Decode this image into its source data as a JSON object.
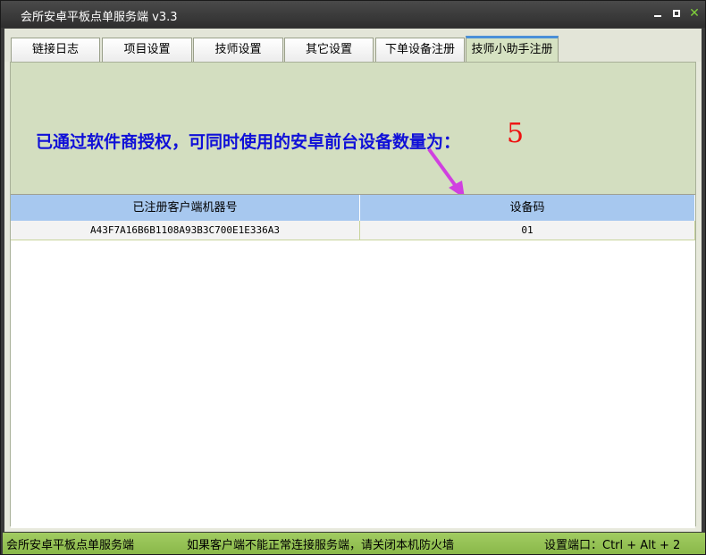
{
  "window": {
    "title": "会所安卓平板点单服务端 v3.3",
    "controls": [
      "minimize-icon",
      "maximize-icon",
      "close-icon"
    ]
  },
  "tabs": [
    {
      "label": "链接日志",
      "active": false
    },
    {
      "label": "项目设置",
      "active": false
    },
    {
      "label": "技师设置",
      "active": false
    },
    {
      "label": "其它设置",
      "active": false
    },
    {
      "label": "下单设备注册",
      "active": false
    },
    {
      "label": "技师小助手注册",
      "active": true
    }
  ],
  "notice": {
    "text": "已通过软件商授权，可同时使用的安卓前台设备数量为：",
    "count": "5"
  },
  "table": {
    "columns": [
      "已注册客户端机器号",
      "设备码"
    ],
    "rows": [
      [
        "A43F7A16B6B1108A93B3C700E1E336A3",
        "01"
      ]
    ]
  },
  "statusbar": {
    "app_name": "会所安卓平板点单服务端",
    "hint": "如果客户端不能正常连接服务端，请关闭本机防火墙",
    "shortcut": "设置端口：Ctrl + Alt + 2"
  },
  "colors": {
    "title_bg": "#2e2e2e",
    "tab_active_accent": "#4a8fd8",
    "panel_bg": "#d3dec0",
    "notice_text": "#1010d8",
    "notice_count": "#ee1010",
    "table_header": "#a7c8ef",
    "status_bg": "#96c354",
    "arrow": "#d040e0"
  }
}
